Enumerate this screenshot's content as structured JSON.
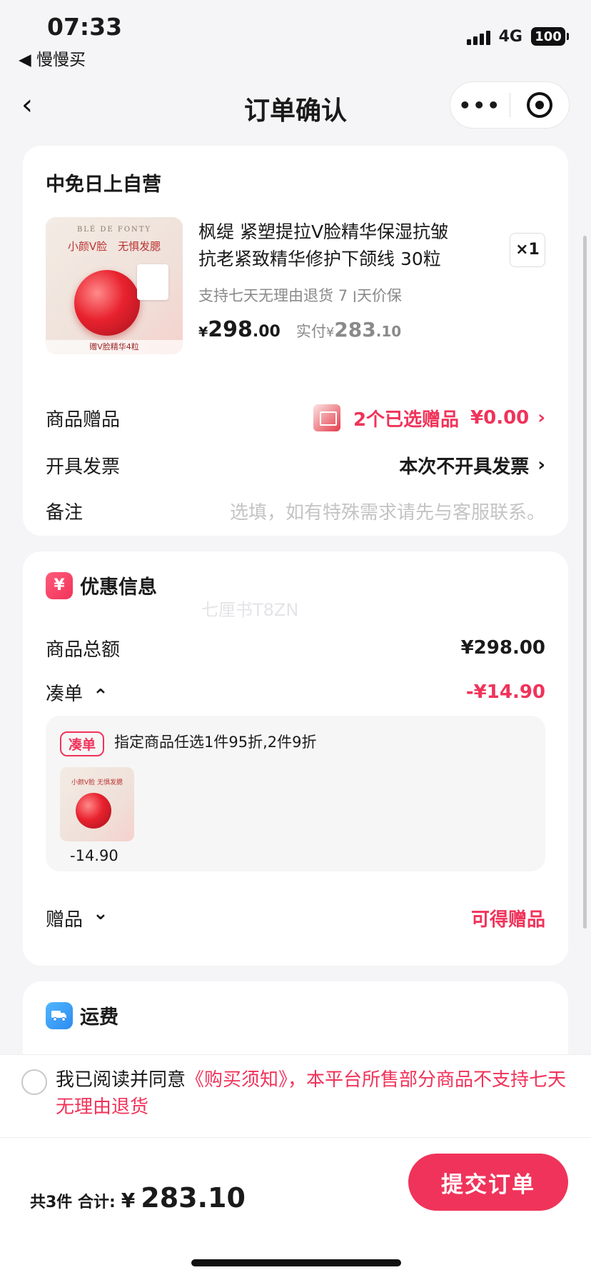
{
  "status_bar": {
    "time": "07:33",
    "back_app": "◀ 慢慢买",
    "network": "4G",
    "battery": "100"
  },
  "nav": {
    "back_icon": "‹",
    "title": "订单确认",
    "more_icon": "•••"
  },
  "order": {
    "store_name": "中免日上自营",
    "product": {
      "image_brand": "BLÉ DE FONTY",
      "image_slogan": "小颜V脸　无惧发腮",
      "image_caption": "赠V脸精华4粒",
      "name": "枫缇 紧塑提拉V脸精华保湿抗皱抗老紧致精华修护下颌线 30粒 （…",
      "quantity": "×1",
      "policy": "支持七天无理由退货 ׀ 7天价保",
      "price_currency": "¥",
      "price_int": "298",
      "price_dec": ".00",
      "paid_label": "实付",
      "paid_currency": "¥",
      "paid_int": "283",
      "paid_dec": ".10"
    },
    "gifts_row": {
      "label": "商品赠品",
      "value": "2个已选赠品",
      "amount": "¥0.00",
      "chevron": "›"
    },
    "invoice_row": {
      "label": "开具发票",
      "value": "本次不开具发票",
      "chevron": "›"
    },
    "remark_row": {
      "label": "备注",
      "placeholder": "选填，如有特殊需求请先与客服联系。"
    }
  },
  "discount": {
    "icon_text": "¥",
    "title": "优惠信息",
    "watermark": "七厘书T8ZN",
    "subtotal_label": "商品总额",
    "subtotal_value": "¥298.00",
    "bundle_label": "凑单",
    "bundle_arrow": "⌃",
    "bundle_value": "-¥14.90",
    "bundle_tag": "凑单",
    "bundle_text": "指定商品任选1件95折,2件9折",
    "bundle_item_price": "-14.90",
    "bundle_thumb_slogan": "小颜V脸 无惧发腮",
    "gift_label": "赠品",
    "gift_arrow": "⌄",
    "gift_value": "可得赠品"
  },
  "shipping": {
    "title": "运费"
  },
  "agreement": {
    "prefix": "我已阅读并同意",
    "link": "《购买须知》，本平台所售部分商品不支持七天无理由退货"
  },
  "bottom_bar": {
    "count_text": "共3件 合计:",
    "total_currency": "¥",
    "total_value": "283.10",
    "submit_label": "提交订单"
  },
  "colors": {
    "accent": "#f0335a",
    "background": "#f5f5f7"
  }
}
